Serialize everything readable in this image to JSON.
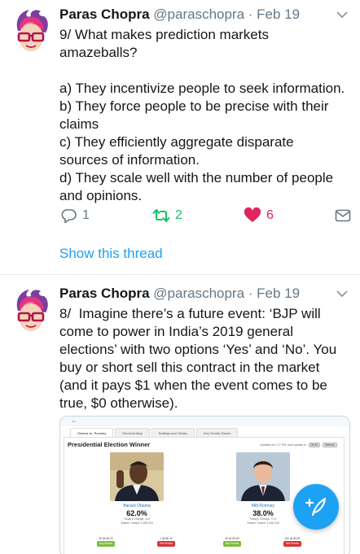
{
  "tweets": [
    {
      "author_name": "Paras Chopra",
      "handle": "@paraschopra",
      "separator": " · ",
      "date": "Feb 19",
      "text": "9/ What makes prediction markets\namazeballs?\n\na) They incentivize people to seek information.\nb) They force people to be precise with their\nclaims\nc) They efficiently aggregate disparate\nsources of information.\nd) They scale well with the number of people\nand opinions.",
      "reply_count": "1",
      "retweet_count": "2",
      "like_count": "6",
      "show_thread": "Show this thread"
    },
    {
      "author_name": "Paras Chopra",
      "handle": "@paraschopra",
      "separator": " · ",
      "date": "Feb 19",
      "text": "8/  Imagine there’s a future event: ‘BJP will\ncome to power in India’s 2019 general\nelections’ with two options ‘Yes’ and ‘No’. You\nbuy or short sell this contract in the market\n(and it pays $1 when the event comes to be\ntrue, $0 otherwise)."
    }
  ],
  "embed": {
    "tabs": [
      "Obama vs. Romney",
      "Electoral Map",
      "Battleground States",
      "Key Senate Races"
    ],
    "title": "Presidential Election Winner",
    "updated": "Updated at 1:17 PM, next update in",
    "countdown": "00:34",
    "refresh": "Refresh",
    "candidates": [
      {
        "name": "Barack Obama",
        "pct": "62.0%",
        "change_label": "Today's Change:",
        "change": "-0.2",
        "traded_label": "Shares Traded:",
        "traded": "1,059,316",
        "buy_price": "30 @ $6.20",
        "sell_price": "1 @ $6.10",
        "buy_label": "Buy Shares",
        "sell_label": "Sell Shares"
      },
      {
        "name": "Mitt Romney",
        "pct": "38.0%",
        "change_label": "Today's Change:",
        "change": "+0.3",
        "traded_label": "Shares Traded:",
        "traded": "1,006,245",
        "buy_price": "26 @ $3.83",
        "sell_price": "100 @ $3.81",
        "buy_label": "Buy Shares",
        "sell_label": "Sell Shares"
      }
    ]
  },
  "colors": {
    "accent": "#1da1f2",
    "retweet": "#17bf63",
    "like": "#e0245e",
    "muted": "#657786"
  },
  "icons": [
    "avatar-logo-icon",
    "chevron-down-icon",
    "reply-icon",
    "retweet-icon",
    "heart-icon",
    "message-icon",
    "compose-tweet-icon"
  ]
}
